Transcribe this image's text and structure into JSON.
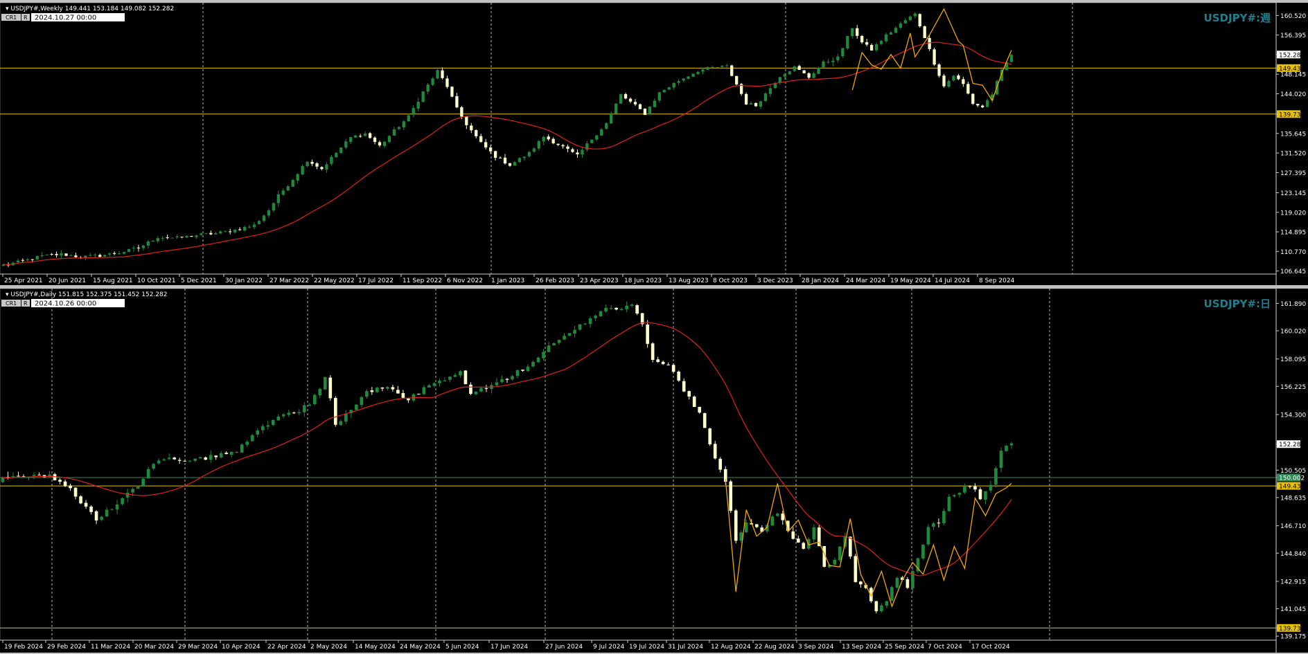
{
  "colors": {
    "background": "#000000",
    "frame": "#c0c0c0",
    "axis_text": "#ffffff",
    "grid": "#c8c8c8",
    "bull_candle": "#1f8a3c",
    "bear_candle": "#ffffcc",
    "ma_line": "#e0201c",
    "zigzag": "#f0a800",
    "hline": "#e8c200",
    "symbol_label": "#1e7f8f",
    "price_tag": "#ffffff",
    "level_tag": "#e8c200",
    "green_tag": "#2e8b57"
  },
  "chart_data": [
    {
      "type": "candlestick",
      "header": "USDJPY#,Weekly  149.441 153.184 149.082 152.282",
      "badge_cr": "CR1",
      "badge_r": "R",
      "datetime_box": "2024.10.27 00:00",
      "symbol_label": "USDJPY#:週",
      "y_ticks": [
        "160.520",
        "156.395",
        "152.282",
        "149.432",
        "148.145",
        "144.020",
        "139.735",
        "135.645",
        "131.520",
        "127.395",
        "123.145",
        "119.020",
        "114.895",
        "110.770",
        "106.645"
      ],
      "x_ticks": [
        "25 Apr 2021",
        "20 Jun 2021",
        "15 Aug 2021",
        "10 Oct 2021",
        "5 Dec 2021",
        "30 Jan 2022",
        "27 Mar 2022",
        "22 May 2022",
        "17 Jul 2022",
        "11 Sep 2022",
        "6 Nov 2022",
        "1 Jan 2023",
        "26 Feb 2023",
        "23 Apr 2023",
        "18 Jun 2023",
        "13 Aug 2023",
        "8 Oct 2023",
        "3 Dec 2023",
        "28 Jan 2024",
        "24 Mar 2024",
        "19 May 2024",
        "14 Jul 2024",
        "8 Sep 2024"
      ],
      "ylim": [
        106.0,
        163.2
      ],
      "price_tag": "152.282",
      "hlines": [
        {
          "value": 149.432,
          "label": "149.432",
          "tag": "level"
        },
        {
          "value": 139.735,
          "label": "139.735",
          "tag": "level"
        }
      ],
      "anchors": [
        [
          0,
          107.9
        ],
        [
          4,
          108.7
        ],
        [
          8,
          109.8
        ],
        [
          12,
          110.2
        ],
        [
          16,
          109.6
        ],
        [
          20,
          109.9
        ],
        [
          24,
          110.5
        ],
        [
          28,
          111.5
        ],
        [
          32,
          113.8
        ],
        [
          36,
          113.6
        ],
        [
          40,
          114.2
        ],
        [
          44,
          114.6
        ],
        [
          48,
          115.3
        ],
        [
          52,
          116.3
        ],
        [
          55,
          119.5
        ],
        [
          57,
          122.5
        ],
        [
          60,
          126.0
        ],
        [
          63,
          130.0
        ],
        [
          66,
          128.2
        ],
        [
          68,
          130.5
        ],
        [
          72,
          134.8
        ],
        [
          75,
          135.6
        ],
        [
          78,
          133.0
        ],
        [
          81,
          136.2
        ],
        [
          84,
          139.2
        ],
        [
          87,
          144.4
        ],
        [
          90,
          148.8
        ],
        [
          92,
          145.6
        ],
        [
          94,
          140.8
        ],
        [
          96,
          137.6
        ],
        [
          99,
          133.6
        ],
        [
          102,
          130.8
        ],
        [
          105,
          129.0
        ],
        [
          109,
          131.5
        ],
        [
          112,
          135.0
        ],
        [
          116,
          132.8
        ],
        [
          119,
          130.9
        ],
        [
          122,
          134.5
        ],
        [
          125,
          137.8
        ],
        [
          128,
          143.8
        ],
        [
          131,
          141.5
        ],
        [
          133,
          139.8
        ],
        [
          136,
          144.2
        ],
        [
          140,
          146.8
        ],
        [
          144,
          148.9
        ],
        [
          147,
          149.5
        ],
        [
          150,
          149.8
        ],
        [
          152,
          146.0
        ],
        [
          154,
          142.0
        ],
        [
          156,
          141.5
        ],
        [
          158,
          144.0
        ],
        [
          161,
          147.8
        ],
        [
          164,
          149.6
        ],
        [
          167,
          147.5
        ],
        [
          170,
          150.5
        ],
        [
          173,
          151.6
        ],
        [
          176,
          158.0
        ],
        [
          178,
          154.8
        ],
        [
          180,
          153.3
        ],
        [
          183,
          156.3
        ],
        [
          187,
          159.5
        ],
        [
          189,
          160.8
        ],
        [
          191,
          156.0
        ],
        [
          193,
          150.5
        ],
        [
          195,
          145.6
        ],
        [
          197,
          147.9
        ],
        [
          199,
          146.0
        ],
        [
          201,
          142.0
        ],
        [
          203,
          141.2
        ],
        [
          205,
          144.0
        ],
        [
          207,
          148.8
        ],
        [
          209,
          152.3
        ]
      ],
      "n_candles": 210,
      "ma_period": 26,
      "zigzag_points": [
        [
          176,
          144.8
        ],
        [
          178,
          152.7
        ],
        [
          180,
          150.1
        ],
        [
          182,
          149.2
        ],
        [
          184,
          152.3
        ],
        [
          186,
          149.4
        ],
        [
          188,
          156.8
        ],
        [
          189,
          151.8
        ],
        [
          192,
          156.4
        ],
        [
          195,
          161.9
        ],
        [
          198,
          155.1
        ],
        [
          199,
          154.2
        ],
        [
          201,
          146.2
        ],
        [
          203,
          145.8
        ],
        [
          205,
          142.6
        ],
        [
          207,
          148.4
        ],
        [
          209,
          153.2
        ]
      ],
      "zigzag_start_index": 180,
      "zigzag_note_index_offset": 32
    },
    {
      "type": "candlestick",
      "header": "USDJPY#,Daily  151.815 152.375 151.452 152.282",
      "badge_cr": "CR1",
      "badge_r": "R",
      "datetime_box": "2024.10.26 00:00",
      "symbol_label": "USDJPY#:日",
      "y_ticks": [
        "161.890",
        "160.020",
        "158.095",
        "156.225",
        "154.300",
        "152.282",
        "150.505",
        "150.002",
        "149.432",
        "148.635",
        "146.710",
        "144.840",
        "142.915",
        "141.045",
        "139.735",
        "139.175"
      ],
      "x_ticks": [
        "19 Feb 2024",
        "29 Feb 2024",
        "11 Mar 2024",
        "20 Mar 2024",
        "29 Mar 2024",
        "10 Apr 2024",
        "22 Apr 2024",
        "2 May 2024",
        "14 May 2024",
        "24 May 2024",
        "5 Jun 2024",
        "17 Jun 2024",
        "27 Jun 2024",
        "9 Jul 2024",
        "19 Jul 2024",
        "31 Jul 2024",
        "12 Aug 2024",
        "22 Aug 2024",
        "3 Sep 2024",
        "13 Sep 2024",
        "25 Sep 2024",
        "7 Oct 2024",
        "17 Oct 2024"
      ],
      "ylim": [
        138.9,
        162.9
      ],
      "price_tag": "152.282",
      "hlines": [
        {
          "value": 150.002,
          "label": "150.002",
          "tag": "green"
        },
        {
          "value": 149.432,
          "label": "149.432",
          "tag": "level"
        },
        {
          "value": 139.735,
          "label": "139.735",
          "tag": "level"
        }
      ],
      "anchors": [
        [
          0,
          149.9
        ],
        [
          5,
          150.2
        ],
        [
          9,
          150.1
        ],
        [
          13,
          149.2
        ],
        [
          15,
          148.3
        ],
        [
          18,
          147.2
        ],
        [
          21,
          147.9
        ],
        [
          24,
          149.1
        ],
        [
          26,
          149.5
        ],
        [
          29,
          151.0
        ],
        [
          33,
          151.3
        ],
        [
          37,
          151.2
        ],
        [
          41,
          151.5
        ],
        [
          45,
          151.8
        ],
        [
          49,
          153.2
        ],
        [
          53,
          154.2
        ],
        [
          57,
          154.6
        ],
        [
          59,
          155.0
        ],
        [
          62,
          156.8
        ],
        [
          63,
          155.3
        ],
        [
          64,
          153.6
        ],
        [
          66,
          154.3
        ],
        [
          70,
          155.8
        ],
        [
          74,
          156.2
        ],
        [
          78,
          155.3
        ],
        [
          82,
          156.3
        ],
        [
          86,
          156.8
        ],
        [
          88,
          157.2
        ],
        [
          90,
          155.8
        ],
        [
          93,
          156.1
        ],
        [
          97,
          156.8
        ],
        [
          101,
          157.6
        ],
        [
          105,
          158.9
        ],
        [
          109,
          159.8
        ],
        [
          113,
          160.9
        ],
        [
          116,
          161.6
        ],
        [
          119,
          161.5
        ],
        [
          121,
          161.9
        ],
        [
          123,
          160.4
        ],
        [
          125,
          158.1
        ],
        [
          128,
          157.7
        ],
        [
          131,
          156.0
        ],
        [
          134,
          154.3
        ],
        [
          137,
          151.3
        ],
        [
          139,
          149.6
        ],
        [
          141,
          145.8
        ],
        [
          143,
          146.9
        ],
        [
          146,
          146.4
        ],
        [
          149,
          147.6
        ],
        [
          152,
          145.9
        ],
        [
          154,
          145.2
        ],
        [
          156,
          146.6
        ],
        [
          158,
          144.0
        ],
        [
          160,
          144.3
        ],
        [
          162,
          146.0
        ],
        [
          164,
          143.0
        ],
        [
          166,
          142.5
        ],
        [
          168,
          140.8
        ],
        [
          170,
          141.7
        ],
        [
          172,
          143.2
        ],
        [
          174,
          142.6
        ],
        [
          176,
          144.4
        ],
        [
          178,
          146.6
        ],
        [
          180,
          147.0
        ],
        [
          182,
          148.6
        ],
        [
          184,
          149.0
        ],
        [
          186,
          149.5
        ],
        [
          188,
          148.6
        ],
        [
          190,
          149.6
        ],
        [
          192,
          151.8
        ],
        [
          194,
          152.3
        ]
      ],
      "n_candles": 195,
      "ma_period": 20,
      "zigzag_points": [
        [
          139,
          149.9
        ],
        [
          141,
          142.2
        ],
        [
          143,
          147.8
        ],
        [
          145,
          146.0
        ],
        [
          147,
          146.6
        ],
        [
          149,
          149.6
        ],
        [
          151,
          146.3
        ],
        [
          153,
          147.1
        ],
        [
          155,
          145.4
        ],
        [
          157,
          145.6
        ],
        [
          159,
          144.0
        ],
        [
          161,
          143.9
        ],
        [
          163,
          147.2
        ],
        [
          165,
          143.4
        ],
        [
          167,
          141.9
        ],
        [
          169,
          143.6
        ],
        [
          171,
          141.2
        ],
        [
          173,
          143.0
        ],
        [
          175,
          144.2
        ],
        [
          177,
          143.4
        ],
        [
          179,
          145.4
        ],
        [
          181,
          143.0
        ],
        [
          183,
          145.3
        ],
        [
          185,
          143.8
        ],
        [
          187,
          148.6
        ],
        [
          189,
          147.4
        ],
        [
          191,
          148.9
        ],
        [
          193,
          149.3
        ],
        [
          194,
          149.6
        ]
      ],
      "zigzag_start_index": 139,
      "zigzag_note_index_offset": 0
    }
  ]
}
